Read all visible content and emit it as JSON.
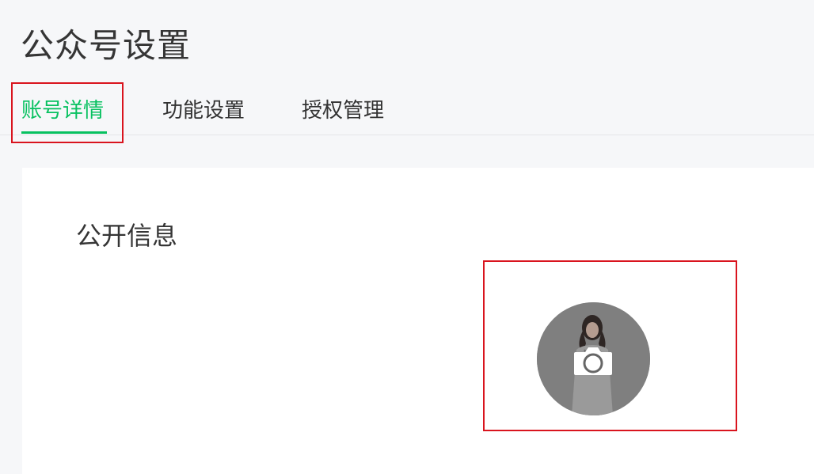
{
  "page": {
    "title": "公众号设置"
  },
  "tabs": [
    {
      "label": "账号详情",
      "active": true
    },
    {
      "label": "功能设置",
      "active": false
    },
    {
      "label": "授权管理",
      "active": false
    }
  ],
  "card": {
    "section_title": "公开信息"
  },
  "avatar": {
    "icon": "camera-icon",
    "overlay_color": "#7f7f7f"
  },
  "colors": {
    "accent": "#07c160",
    "highlight": "#d9141e"
  }
}
